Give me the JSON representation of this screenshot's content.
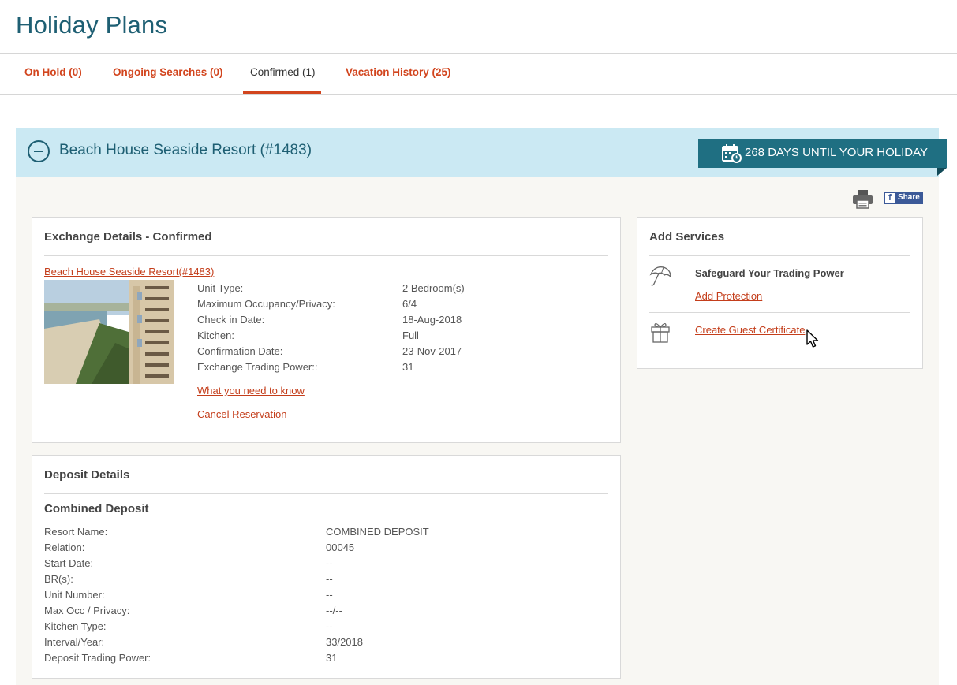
{
  "page_title": "Holiday Plans",
  "tabs": [
    {
      "label": "On Hold (0)"
    },
    {
      "label": "Ongoing Searches (0)"
    },
    {
      "label": "Confirmed (1)"
    },
    {
      "label": "Vacation History (25)"
    }
  ],
  "banner": {
    "resort_title": "Beach House Seaside Resort (#1483)",
    "countdown": "268 DAYS UNTIL YOUR HOLIDAY"
  },
  "share": {
    "label": "Share"
  },
  "exchange": {
    "title": "Exchange Details - Confirmed",
    "resort_link": "Beach House Seaside Resort(#1483)",
    "rows": [
      {
        "label": "Unit Type:",
        "value": "2 Bedroom(s)"
      },
      {
        "label": "Maximum Occupancy/Privacy:",
        "value": "6/4"
      },
      {
        "label": "Check in Date:",
        "value": "18-Aug-2018"
      },
      {
        "label": "Kitchen:",
        "value": "Full"
      },
      {
        "label": "Confirmation Date:",
        "value": "23-Nov-2017"
      },
      {
        "label": "Exchange Trading Power::",
        "value": "31"
      }
    ],
    "link_need_to_know": "What you need to know",
    "link_cancel": "Cancel Reservation"
  },
  "deposit": {
    "title": "Deposit Details",
    "subtitle": "Combined Deposit",
    "rows": [
      {
        "label": "Resort Name:",
        "value": "COMBINED DEPOSIT"
      },
      {
        "label": "Relation:",
        "value": "00045"
      },
      {
        "label": "Start Date:",
        "value": "--"
      },
      {
        "label": "BR(s):",
        "value": "--"
      },
      {
        "label": "Unit Number:",
        "value": "--"
      },
      {
        "label": "Max Occ / Privacy:",
        "value": "--/--"
      },
      {
        "label": "Kitchen Type:",
        "value": "--"
      },
      {
        "label": "Interval/Year:",
        "value": "33/2018"
      },
      {
        "label": "Deposit Trading Power:",
        "value": "31"
      }
    ]
  },
  "services": {
    "title": "Add Services",
    "safeguard_title": "Safeguard Your Trading Power",
    "add_protection": "Add Protection",
    "guest_certificate": "Create Guest Certificate"
  },
  "icons": {
    "collapse": "minus-circle-icon",
    "calendar": "calendar-clock-icon",
    "print": "printer-icon",
    "facebook": "facebook-icon",
    "umbrella": "umbrella-icon",
    "gift": "gift-icon",
    "cursor": "mouse-pointer-icon"
  },
  "colors": {
    "brand_teal": "#1e5f73",
    "accent_orange": "#d2451e",
    "banner_bg": "#cbe9f3",
    "countdown_bg": "#1f6f82",
    "facebook_blue": "#3b5998"
  }
}
